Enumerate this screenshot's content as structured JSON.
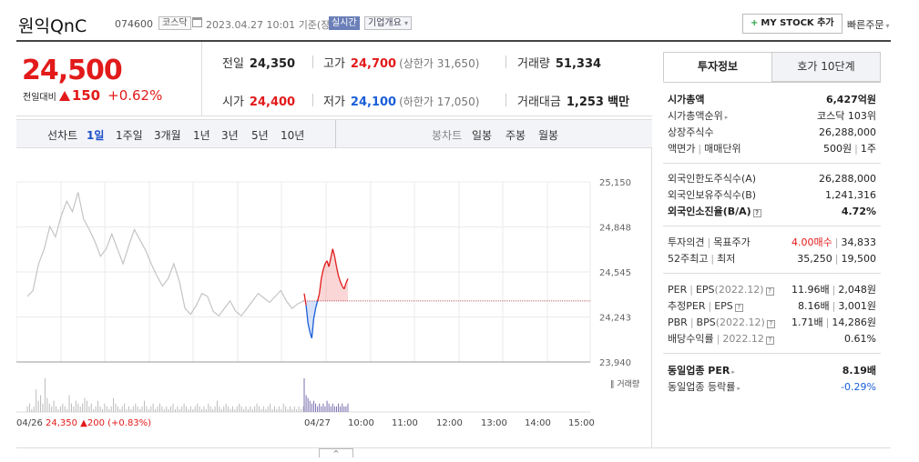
{
  "header": {
    "stock_name": "원익QnC",
    "stock_code": "074600",
    "market": "코스닥",
    "datetime": "2023.04.27 10:01",
    "basis": "기준(장중)",
    "realtime_badge": "실시간",
    "overview_label": "기업개요",
    "overview_caret": "▾",
    "mystock_label": "MY STOCK 추가",
    "mystock_plus": "+",
    "quick_order_label": "빠른주문",
    "quick_order_caret": "▾"
  },
  "price": {
    "current": "24,500",
    "change_label": "전일대비",
    "change_value": "150",
    "change_pct": "+0.62%"
  },
  "stats": {
    "prev_close": {
      "label": "전일",
      "value": "24,350"
    },
    "high": {
      "label": "고가",
      "value": "24,700",
      "limit_label": "(상한가 31,650)"
    },
    "volume": {
      "label": "거래량",
      "value": "51,334"
    },
    "open": {
      "label": "시가",
      "value": "24,400"
    },
    "low": {
      "label": "저가",
      "value": "24,100",
      "limit_label": "(하한가 17,050)"
    },
    "amount": {
      "label": "거래대금",
      "value": "1,253",
      "unit": "백만"
    }
  },
  "chart_tabs": {
    "line_chart_label": "선차트",
    "periods": [
      "1일",
      "1주일",
      "3개월",
      "1년",
      "3년",
      "5년",
      "10년"
    ],
    "active_period": "1일",
    "candle_label": "봉차트",
    "candle_periods": [
      "일봉",
      "주봉",
      "월봉"
    ]
  },
  "chart_data": {
    "type": "line",
    "title": "",
    "y_ticks": [
      "25,150",
      "24,848",
      "24,545",
      "24,243",
      "23,940"
    ],
    "ylim": [
      23940,
      25150
    ],
    "x_ticks": [
      "04/26",
      "04/27",
      "10:00",
      "11:00",
      "12:00",
      "13:00",
      "14:00",
      "15:00"
    ],
    "volume_label": "거래량",
    "prev_close": 24350,
    "prev_day_summary": {
      "date": "04/26",
      "close": "24,350",
      "arrow": "▲",
      "change": "200",
      "pct": "(+0.83%)"
    },
    "series": [
      {
        "values": [
          24380,
          24420,
          24600,
          24700,
          24850,
          24780,
          24920,
          25020,
          24950,
          25080,
          24900,
          24830,
          24750,
          24650,
          24700,
          24800,
          24700,
          24600,
          24720,
          24830,
          24760,
          24690,
          24600,
          24520,
          24450,
          24500,
          24600,
          24480,
          24300,
          24260,
          24320,
          24400,
          24380,
          24280,
          24250,
          24300,
          24350,
          24280,
          24250,
          24300,
          24350,
          24400,
          24370,
          24340,
          24380,
          24420,
          24350,
          24300,
          24330,
          24350
        ]
      },
      {
        "values": [
          24400,
          24320,
          24200,
          24140,
          24100,
          24230,
          24300,
          24350,
          24400,
          24500,
          24560,
          24600,
          24620,
          24580,
          24640,
          24700,
          24650,
          24580,
          24520,
          24480,
          24450,
          24430,
          24470,
          24500
        ]
      }
    ],
    "volume_bars": [
      2,
      3,
      1,
      2,
      8,
      4,
      6,
      3,
      12,
      5,
      3,
      2,
      4,
      2,
      1,
      2,
      3,
      2,
      1,
      6,
      3,
      2,
      4,
      3,
      2,
      3,
      5,
      4,
      2,
      3,
      1,
      2,
      4,
      2,
      1,
      3,
      2,
      1,
      2,
      5,
      3,
      2,
      1,
      2,
      3,
      1,
      2,
      1,
      2,
      3,
      2,
      1,
      2,
      4,
      2,
      1,
      2,
      3,
      1,
      2,
      3,
      2,
      1,
      2,
      1,
      2,
      3,
      1,
      2,
      1,
      2,
      3,
      2,
      1,
      2,
      1,
      2,
      3,
      2,
      1,
      2,
      1,
      3,
      2,
      1,
      2,
      4,
      2,
      1,
      2,
      3,
      2,
      1,
      2,
      1,
      2,
      3,
      2,
      1,
      2,
      1,
      2,
      1,
      2,
      3,
      2,
      1,
      2,
      1,
      2,
      3,
      1,
      2,
      1,
      2,
      1,
      3,
      2,
      1,
      2,
      1,
      2,
      1,
      2,
      1,
      2
    ],
    "today_volume_bars": [
      12,
      6,
      5,
      4,
      3,
      4,
      3,
      2,
      3,
      2,
      3,
      2,
      4,
      3,
      2,
      3,
      2,
      2,
      3,
      2,
      3,
      2,
      2,
      3
    ]
  },
  "right_panel": {
    "tabs": [
      "투자정보",
      "호가 10단계"
    ],
    "market_cap": {
      "label": "시가총액",
      "value": "6,427억원"
    },
    "cap_rank": {
      "label": "시가총액순위",
      "value": "코스닥 103위"
    },
    "shares": {
      "label": "상장주식수",
      "value": "26,288,000"
    },
    "par_label": "액면가",
    "unit_label": "매매단위",
    "par_value": "500원",
    "unit_value": "1주",
    "foreign_limit": {
      "label": "외국인한도주식수(A)",
      "value": "26,288,000"
    },
    "foreign_hold": {
      "label": "외국인보유주식수(B)",
      "value": "1,241,316"
    },
    "foreign_ratio": {
      "label": "외국인소진율(B/A)",
      "value": "4.72%"
    },
    "opinion_label": "투자의견",
    "target_label": "목표주가",
    "opinion_value": "4.00매수",
    "target_value": "34,833",
    "week52_high_label": "52주최고",
    "week52_low_label": "최저",
    "week52_high": "35,250",
    "week52_low": "19,500",
    "per_label": "PER",
    "eps_label": "EPS",
    "eps_year": "(2022.12)",
    "per_value": "11.96배",
    "eps_value": "2,048원",
    "est_per_label": "추정PER",
    "est_eps_label": "EPS",
    "est_per_value": "8.16배",
    "est_eps_value": "3,001원",
    "pbr_label": "PBR",
    "bps_label": "BPS",
    "bps_year": "(2022.12)",
    "pbr_value": "1.71배",
    "bps_value": "14,286원",
    "div_label": "배당수익률",
    "div_year": "2022.12",
    "div_value": "0.61%",
    "sector_per": {
      "label": "동일업종 PER",
      "value": "8.19배"
    },
    "sector_change": {
      "label": "동일업종 등락률",
      "value": "-0.29%"
    }
  },
  "colors": {
    "up": "#e21a1a",
    "down": "#1a5ed8",
    "line": "#c4c4c4",
    "realtime_badge": "#6b7fb8"
  },
  "toggle_icon": "^"
}
